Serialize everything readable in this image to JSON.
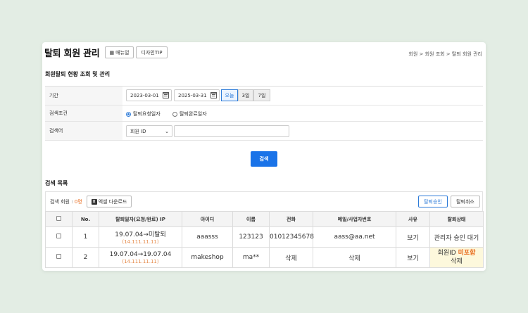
{
  "header": {
    "title": "탈퇴 회원 관리",
    "manual_label": "매뉴얼",
    "design_tip_label": "디자인TIP",
    "breadcrumb": "회원 > 회원 조회 > 탈퇴 회원 관리"
  },
  "search": {
    "section_title": "회원탈퇴 현황 조회 및 관리",
    "period_label": "기간",
    "date_from": "2023-03-01",
    "date_to": "2025-03-31",
    "tilde": "~",
    "period_buttons": [
      "오늘",
      "3일",
      "7일"
    ],
    "condition_label": "검색조건",
    "condition_options": [
      "탈퇴요청일자",
      "탈퇴완료일자"
    ],
    "keyword_label": "검색어",
    "keyword_select": "회원 ID",
    "keyword_value": "",
    "search_button": "검색"
  },
  "list": {
    "section_title": "검색 목록",
    "count_label": "검색 회원 : ",
    "count_value": "0명",
    "excel_label": "엑셀 다운로드",
    "excel_icon": "X",
    "approve_label": "탈퇴승인",
    "cancel_label": "탈퇴취소",
    "columns": [
      "No.",
      "탈퇴일자(요청/완료) IP",
      "아이디",
      "이름",
      "전화",
      "메일/사업자번호",
      "사유",
      "탈퇴상태"
    ],
    "rows": [
      {
        "no": "1",
        "date": "19.07.04→미탈퇴",
        "ip": "(14.111.11.11)",
        "id": "aaasss",
        "name": "123123",
        "phone": "01012345678",
        "mail": "aass@aa.net",
        "reason": "보기",
        "status": "관리자 승인 대기"
      },
      {
        "no": "2",
        "date": "19.07.04→19.07.04",
        "ip": "(14.111.11.11)",
        "id": "makeshop",
        "name": "ma**",
        "phone": "삭제",
        "mail": "삭제",
        "reason": "보기",
        "status_prefix": "회원ID ",
        "status_mark": "미포함",
        "status_suffix": "삭제"
      }
    ]
  },
  "colors": {
    "accent": "#1a73e8",
    "orange": "#e86a1b",
    "background": "#e3ede4"
  }
}
